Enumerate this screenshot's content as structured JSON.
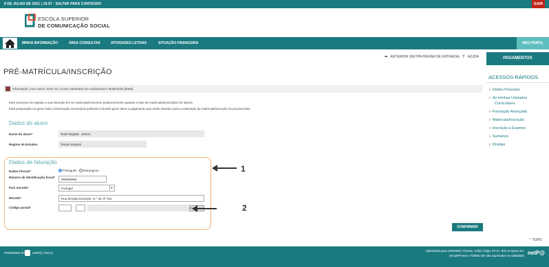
{
  "topbar": {
    "left_text": "8 DE JULHO DE 2021 | 19:57  ·  SALTAR PARA CONTEÚDO",
    "sair": "SAIR"
  },
  "logo": {
    "line1": "ESCOLA SUPERIOR",
    "line2": "DE COMUNICAÇÃO SOCIAL"
  },
  "nav": {
    "items": [
      "MINHA INFORMAÇÃO",
      "ÁREA CONSULTAS",
      "ATIVIDADES LETIVAS",
      "SITUAÇÃO FINANCEIRA"
    ],
    "perfil": "MEU PERFIL"
  },
  "top_links": {
    "anterior": "ANTERIOR (NETPA PÁGINA DE ENTRADA)",
    "ajuda": "AJUDA"
  },
  "page_title": "PRÉ-MATRÍCULA/INSCRIÇÃO",
  "infobar": "Informação  |  Ano Letivo: 2021-22  |  Curso: Mestrado em Audiovisual e Multimédia [6550]",
  "description": [
    "Este processo irá registar a sua intenção em se matricular/inscrever posteriormente quando a fase de matrículas/inscrições for aberta.",
    "Esta preparação irá gerar toda a informação necessária podendo inclusivé gerar itens a pagamento que serão devidos para a realização de matrícula/inscrição na próxima fase"
  ],
  "dados_aluno": {
    "title": "Dados do aluno",
    "nome_label": "Nome do aluno*",
    "nome_value": "Teste Digitale - ESCS",
    "regime_label": "Regime de Estudos",
    "regime_value": "Tempo Integral"
  },
  "faturacao": {
    "title": "Dados de faturação",
    "fiscais_label": "Dados Fiscais*",
    "opt_portugues": "Português",
    "opt_estrangeiro": "Estrangeiro",
    "nif_label": "Número de identificação fiscal*",
    "nif_value": "999999990",
    "pais_label": "País morada*",
    "pais_value": "Portugal",
    "morada_label": "Morada*",
    "morada_value": "Rua Morada Exemplo, N.º 25, 8º Dto",
    "cp_label": "Código postal*",
    "pesquisar": "Pesquisar"
  },
  "annotations": {
    "a1": "1",
    "a2": "2"
  },
  "confirmar": "CONFIRMAR",
  "sidebar": {
    "pagamentos": "PAGAMENTOS",
    "acessos_title": "ACESSOS RÁPIDOS",
    "items": [
      "Dados Pessoais",
      "As minhas Unidades",
      "Curriculares",
      "Formação Avançada",
      "Matrícula/Inscrição",
      "Inscrição a Exames",
      "Sumários",
      "Dívidas"
    ]
  },
  "topo": "TOPO",
  "footer": {
    "powered": "POWERED BY",
    "netpa": "netP@ | ESCS",
    "optimized": "Optimizado para 1440x900 | Chrome, Safari, Edge, FX 5+, IE11 & Opera 10+",
    "smartphones": "(SmartPhones e Tablets não são suportados na totalidade)",
    "brand": "netP@"
  },
  "colors": {
    "primary": "#1a7a80",
    "accent": "#5fbfbf",
    "sair": "#c0271b",
    "highlight": "#f0b27a"
  }
}
